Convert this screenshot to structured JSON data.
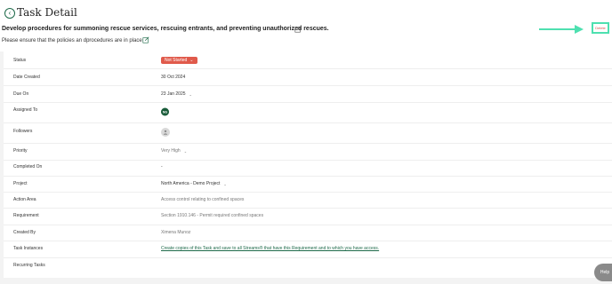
{
  "header": {
    "title": "Task Detail"
  },
  "task": {
    "title": "Develop procedures for summoning rescue services, rescuing entrants, and preventing unauthorized rescues.",
    "subtitle": "Please ensure that the policies an dprocedures are in place",
    "delete_label": "Delete"
  },
  "fields": {
    "status": {
      "label": "Status",
      "value": "Not Started"
    },
    "date_created": {
      "label": "Date Created",
      "value": "30 Oct 2024"
    },
    "due_on": {
      "label": "Due On",
      "value": "23 Jan 2025"
    },
    "assigned_to": {
      "label": "Assigned To",
      "value": "NG"
    },
    "followers": {
      "label": "Followers"
    },
    "priority": {
      "label": "Priority",
      "value": "Very High"
    },
    "completed_on": {
      "label": "Completed On",
      "value": "-"
    },
    "project": {
      "label": "Project",
      "value": "North America - Demo Project"
    },
    "action_area": {
      "label": "Action Area",
      "value": "Access control relating to confined spaces"
    },
    "requirement": {
      "label": "Requirement",
      "value": "Section 1910.146 - Permit required confined spaces"
    },
    "created_by": {
      "label": "Created By",
      "value": "Ximena Munoz"
    },
    "task_instances": {
      "label": "Task Instances",
      "value": "Create copies of this Task and save to all Streams® that have this Requirement and to which you have access."
    },
    "recurring_tasks": {
      "label": "Recurring Tasks"
    }
  },
  "help": {
    "label": "Help"
  },
  "colors": {
    "accent": "#1e6a4a",
    "status_pill": "#e05a4b",
    "delete_text": "#d9534f",
    "highlight": "#4ee0b0"
  }
}
